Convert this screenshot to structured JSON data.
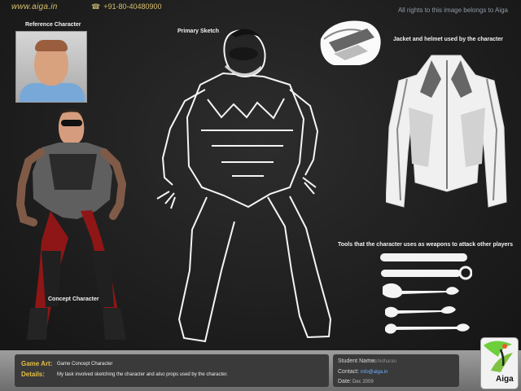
{
  "header": {
    "site_text": "www.aiga.in",
    "phone_text": "+91-80-40480900",
    "rights_text": "All rights to this image belongs to Aiga"
  },
  "labels": {
    "reference": "Reference Character",
    "primary": "Primary Sketch",
    "jacket": "Jacket and helmet used by the character",
    "concept": "Concept Character",
    "tools": "Tools that the character uses as weapons to attack other players"
  },
  "footer": {
    "game_art_label": "Game Art:",
    "game_art_value": "Game Concept Character",
    "details_label": "Details:",
    "details_value": "My task involved sketching the character and also props used by the character.",
    "student_label": "Student Name:",
    "student_value": "Shashidharan",
    "contact_label": "Contact:",
    "contact_value": "info@aiga.in",
    "date_label": "Date:",
    "date_value": "Dec 2009"
  },
  "logo": {
    "text": "Aiga"
  },
  "icons": {
    "phone": "phone-icon",
    "logo": "brand-logo-icon"
  },
  "colors": {
    "header_text": "#d8c06a",
    "footer_label": "#e8bf45",
    "contact_link": "#6fb1ff"
  }
}
